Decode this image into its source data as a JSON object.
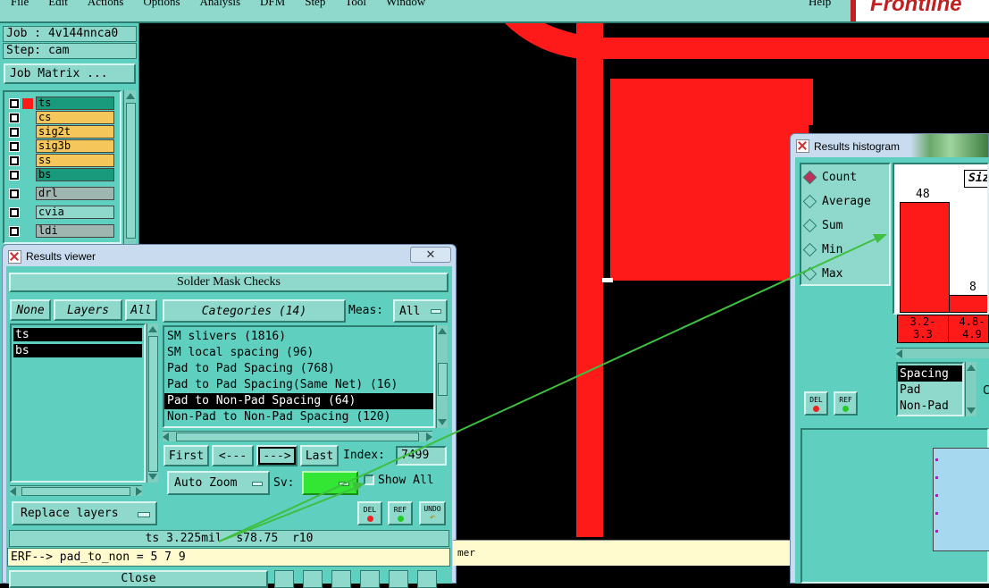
{
  "menubar": {
    "items": [
      "File",
      "Edit",
      "Actions",
      "Options",
      "Analysis",
      "DFM",
      "Step",
      "Tool",
      "Window"
    ],
    "help": "Help",
    "logo": "Frontline"
  },
  "job_panel": {
    "job_label": "Job : 4v144nnca0",
    "step_label": "Step: cam",
    "job_matrix_button": "Job Matrix ...",
    "layers": [
      {
        "name": "ts",
        "color": "#1a9a7c",
        "selected": true
      },
      {
        "name": "cs",
        "color": "#f5c75a"
      },
      {
        "name": "sig2t",
        "color": "#f5c75a"
      },
      {
        "name": "sig3b",
        "color": "#f5c75a"
      },
      {
        "name": "ss",
        "color": "#f5c75a"
      },
      {
        "name": "bs",
        "color": "#1a9a7c"
      },
      {
        "name": "drl",
        "color": "#9fb5b0"
      },
      {
        "name": "cvia",
        "color": "#8ed9cc"
      },
      {
        "name": "ldi",
        "color": "#9fb5b0"
      }
    ]
  },
  "results_viewer": {
    "title": "Results viewer",
    "header": "Solder Mask Checks",
    "none_button": "None",
    "layers_button": "Layers",
    "all_button": "All",
    "layer_list": [
      "ts",
      "bs"
    ],
    "categories_button": "Categories (14)",
    "meas_label": "Meas:",
    "meas_value": "All",
    "categories": [
      "SM slivers (1816)",
      "SM local spacing (96)",
      "Pad to Pad Spacing (768)",
      "Pad to Pad Spacing(Same Net) (16)",
      "Pad to Non-Pad Spacing (64)",
      "Non-Pad to Non-Pad Spacing (120)"
    ],
    "selected_category_index": 4,
    "first_button": "First",
    "prev_button": "<---",
    "next_button": "--->",
    "last_button": "Last",
    "index_label": "Index:",
    "index_value": "7499",
    "auto_zoom": "Auto Zoom",
    "sv_label": "Sv:",
    "show_all": "Show All",
    "replace_layers": "Replace layers",
    "del_label": "DEL",
    "ref_label": "REF",
    "undo_label": "UNDO",
    "status_line": "ts 3.225mil  s78.75  r10",
    "erf_line": "ERF--> pad_to_non = 5 7 9",
    "close_button": "Close"
  },
  "histogram": {
    "title": "Results histogram",
    "modes": [
      "Count",
      "Average",
      "Sum",
      "Min",
      "Max"
    ],
    "selected_mode": "Count",
    "size_label": "Siz",
    "bars": [
      {
        "value": 48,
        "label_line1": "3.2-",
        "label_line2": "3.3"
      },
      {
        "value": 8,
        "label_line1": "4.8-",
        "label_line2": "4.9"
      }
    ],
    "type_list": [
      "Spacing",
      "Pad",
      "Non-Pad"
    ],
    "selected_type": "Spacing",
    "del_label": "DEL",
    "ref_label": "REF",
    "extra_label": "C"
  },
  "canvas_tail": "mer",
  "colors": {
    "panel": "#5fcfbf",
    "panel_light": "#8ed9cc",
    "copper": "#ff1a1a",
    "arrow": "#3fbf3f",
    "sv_swatch": "#33e633"
  }
}
